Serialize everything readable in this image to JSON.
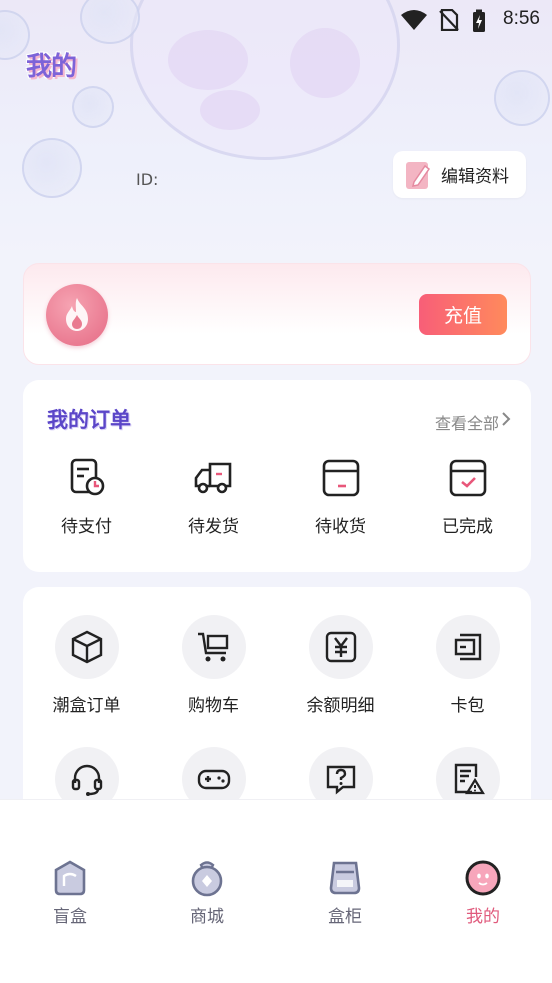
{
  "status_bar": {
    "time": "8:56"
  },
  "header": {
    "title": "我的"
  },
  "profile": {
    "id_label": "ID:",
    "edit_label": "编辑资料"
  },
  "wallet": {
    "recharge_label": "充值"
  },
  "orders": {
    "title": "我的订单",
    "view_all": "查看全部",
    "items": [
      {
        "label": "待支付",
        "icon": "pending-payment-icon"
      },
      {
        "label": "待发货",
        "icon": "truck-icon"
      },
      {
        "label": "待收货",
        "icon": "box-icon"
      },
      {
        "label": "已完成",
        "icon": "box-check-icon"
      }
    ]
  },
  "tools": {
    "items": [
      {
        "label": "潮盒订单",
        "icon": "cube-icon"
      },
      {
        "label": "购物车",
        "icon": "cart-icon"
      },
      {
        "label": "余额明细",
        "icon": "yuan-icon"
      },
      {
        "label": "卡包",
        "icon": "wallet-icon"
      },
      {
        "label": "",
        "icon": "headset-icon"
      },
      {
        "label": "",
        "icon": "gamepad-icon"
      },
      {
        "label": "",
        "icon": "help-icon"
      },
      {
        "label": "",
        "icon": "report-icon"
      }
    ]
  },
  "nav": {
    "items": [
      {
        "label": "盲盒",
        "active": false
      },
      {
        "label": "商城",
        "active": false
      },
      {
        "label": "盒柜",
        "active": false
      },
      {
        "label": "我的",
        "active": true
      }
    ]
  },
  "colors": {
    "accent": "#f85e78",
    "active_nav": "#e05a7c",
    "title_purple": "#5b46c8"
  }
}
